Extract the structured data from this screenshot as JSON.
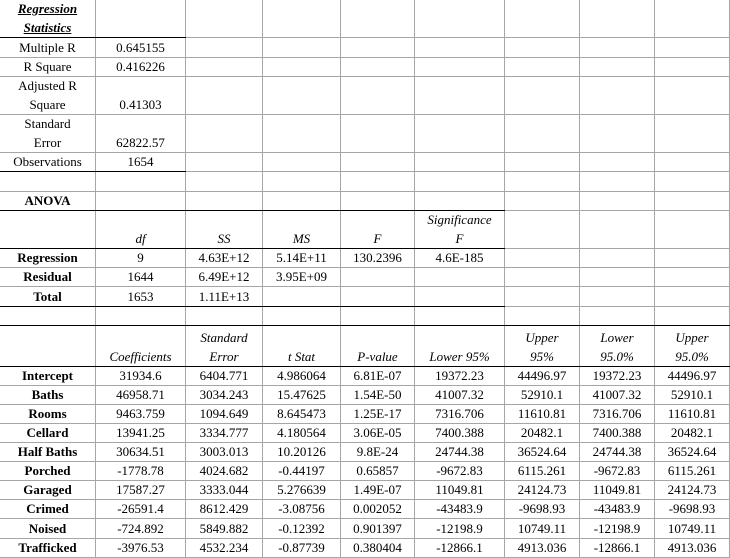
{
  "regression_statistics": {
    "title_line1": "Regression",
    "title_line2": "Statistics",
    "rows": [
      {
        "label": [
          "Multiple R"
        ],
        "value": "0.645155"
      },
      {
        "label": [
          "R Square"
        ],
        "value": "0.416226"
      },
      {
        "label": [
          "Adjusted R",
          "Square"
        ],
        "value": "0.41303"
      },
      {
        "label": [
          "Standard",
          "Error"
        ],
        "value": "62822.57"
      },
      {
        "label": [
          "Observations"
        ],
        "value": "1654"
      }
    ]
  },
  "anova": {
    "title": "ANOVA",
    "headers": [
      "df",
      "SS",
      "MS",
      "F",
      "Significance F"
    ],
    "headers_split": [
      [
        "df"
      ],
      [
        "SS"
      ],
      [
        "MS"
      ],
      [
        "F"
      ],
      [
        "Significance",
        "F"
      ]
    ],
    "rows": [
      {
        "label": "Regression",
        "values": [
          "9",
          "4.63E+12",
          "5.14E+11",
          "130.2396",
          "4.6E-185"
        ]
      },
      {
        "label": "Residual",
        "values": [
          "1644",
          "6.49E+12",
          "3.95E+09",
          "",
          ""
        ]
      },
      {
        "label": "Total",
        "values": [
          "1653",
          "1.11E+13",
          "",
          "",
          ""
        ]
      }
    ]
  },
  "coefficients": {
    "headers": [
      [
        "Coefficients"
      ],
      [
        "Standard",
        "Error"
      ],
      [
        "t Stat"
      ],
      [
        "P-value"
      ],
      [
        "Lower 95%"
      ],
      [
        "Upper",
        "95%"
      ],
      [
        "Lower",
        "95.0%"
      ],
      [
        "Upper",
        "95.0%"
      ]
    ],
    "rows": [
      {
        "label": "Intercept",
        "values": [
          "31934.6",
          "6404.771",
          "4.986064",
          "6.81E-07",
          "19372.23",
          "44496.97",
          "19372.23",
          "44496.97"
        ]
      },
      {
        "label": "Baths",
        "values": [
          "46958.71",
          "3034.243",
          "15.47625",
          "1.54E-50",
          "41007.32",
          "52910.1",
          "41007.32",
          "52910.1"
        ]
      },
      {
        "label": "Rooms",
        "values": [
          "9463.759",
          "1094.649",
          "8.645473",
          "1.25E-17",
          "7316.706",
          "11610.81",
          "7316.706",
          "11610.81"
        ]
      },
      {
        "label": "Cellard",
        "values": [
          "13941.25",
          "3334.777",
          "4.180564",
          "3.06E-05",
          "7400.388",
          "20482.1",
          "7400.388",
          "20482.1"
        ]
      },
      {
        "label": "Half Baths",
        "values": [
          "30634.51",
          "3003.013",
          "10.20126",
          "9.8E-24",
          "24744.38",
          "36524.64",
          "24744.38",
          "36524.64"
        ]
      },
      {
        "label": "Porched",
        "values": [
          "-1778.78",
          "4024.682",
          "-0.44197",
          "0.65857",
          "-9672.83",
          "6115.261",
          "-9672.83",
          "6115.261"
        ]
      },
      {
        "label": "Garaged",
        "values": [
          "17587.27",
          "3333.044",
          "5.276639",
          "1.49E-07",
          "11049.81",
          "24124.73",
          "11049.81",
          "24124.73"
        ]
      },
      {
        "label": "Crimed",
        "values": [
          "-26591.4",
          "8612.429",
          "-3.08756",
          "0.002052",
          "-43483.9",
          "-9698.93",
          "-43483.9",
          "-9698.93"
        ]
      },
      {
        "label": "Noised",
        "values": [
          "-724.892",
          "5849.882",
          "-0.12392",
          "0.901397",
          "-12198.9",
          "10749.11",
          "-12198.9",
          "10749.11"
        ]
      },
      {
        "label": "Trafficked",
        "values": [
          "-3976.53",
          "4532.234",
          "-0.87739",
          "0.380404",
          "-12866.1",
          "4913.036",
          "-12866.1",
          "4913.036"
        ]
      }
    ]
  }
}
